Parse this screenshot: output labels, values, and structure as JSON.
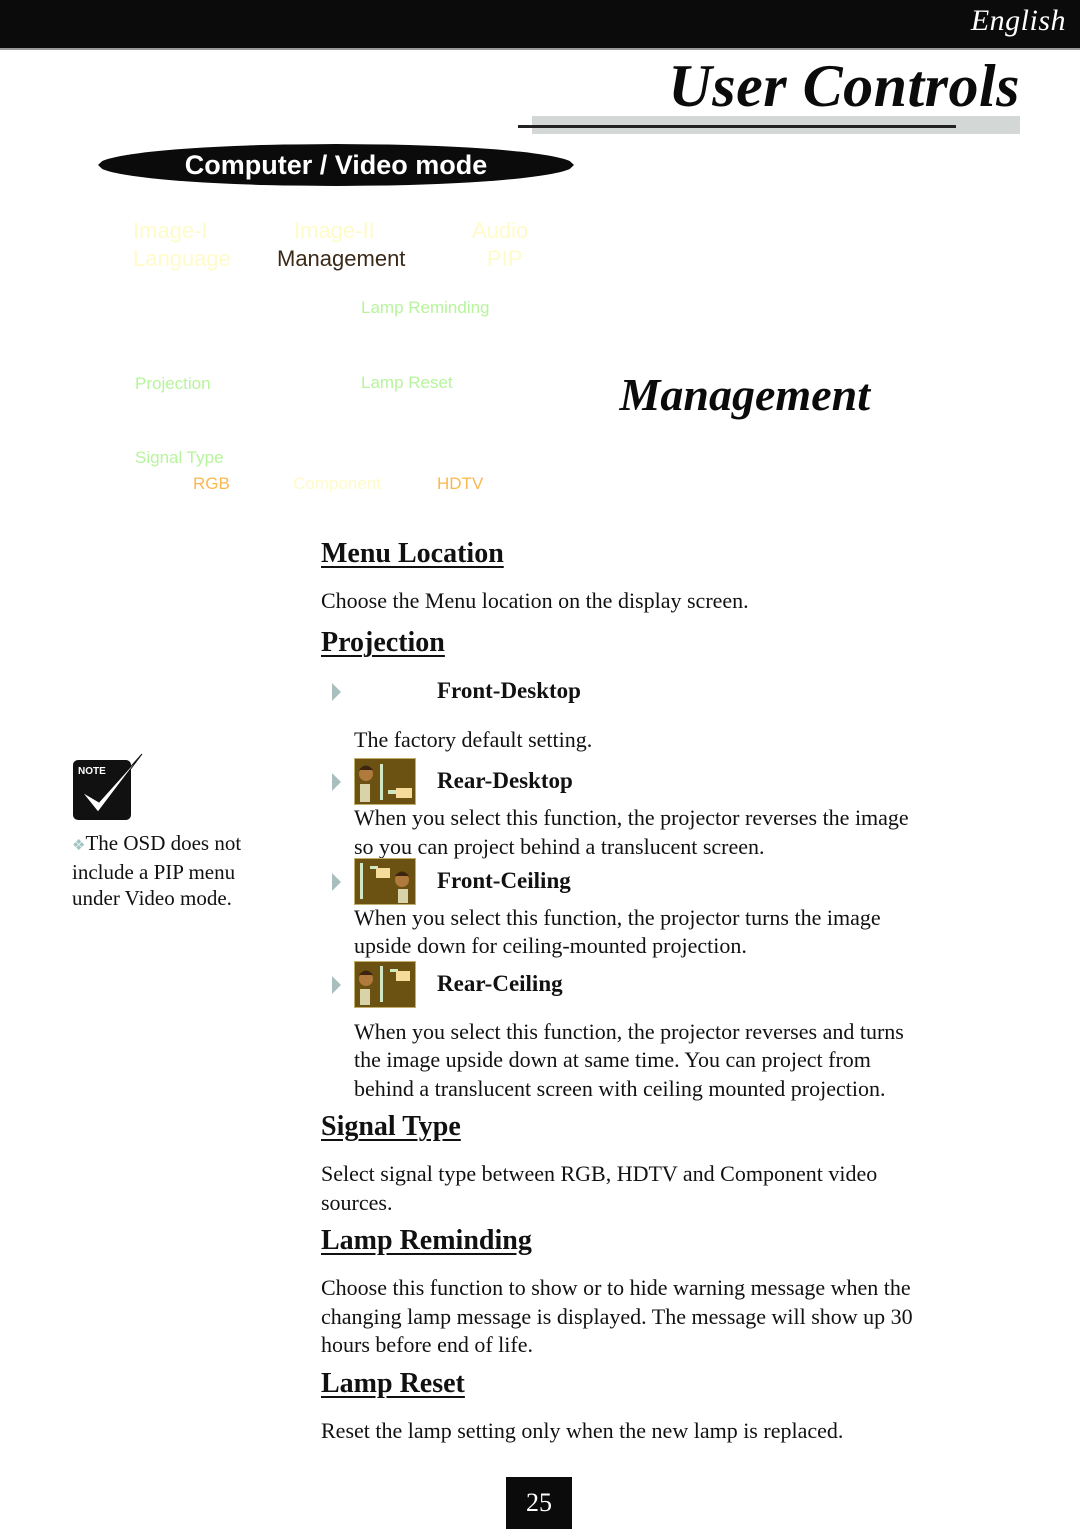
{
  "header": {
    "language": "English",
    "page_title": "User Controls"
  },
  "mode_banner": "Computer / Video mode",
  "osd_menu": {
    "tabs": [
      {
        "label": "Image-I",
        "active": false
      },
      {
        "label": "Image-II",
        "active": false
      },
      {
        "label": "Audio",
        "active": false
      },
      {
        "label": "Language",
        "active": false
      },
      {
        "label": "Management",
        "active": true
      },
      {
        "label": "PIP",
        "active": false
      }
    ],
    "items": {
      "lamp_reminding": "Lamp Reminding",
      "projection": "Projection",
      "lamp_reset": "Lamp Reset",
      "signal_type": "Signal Type"
    },
    "signal_options": [
      {
        "label": "RGB",
        "color": "#fbb84f"
      },
      {
        "label": "Component",
        "color": "#fffbc9"
      },
      {
        "label": "HDTV",
        "color": "#fbb84f"
      }
    ]
  },
  "section_heading": "Management",
  "sections": {
    "menu_location": {
      "title": "Menu Location",
      "text": "Choose the Menu location on the display screen."
    },
    "projection": {
      "title": "Projection",
      "options": [
        {
          "label": "Front-Desktop",
          "icon": "front-desktop-icon",
          "text": "The factory default setting."
        },
        {
          "label": "Rear-Desktop",
          "icon": "rear-desktop-icon",
          "text_lines": [
            "When you select this function, the projector reverses the image",
            "so you can project behind a translucent screen."
          ]
        },
        {
          "label": "Front-Ceiling",
          "icon": "front-ceiling-icon",
          "text_lines": [
            "When you select this function, the projector turns the image",
            "upside down for ceiling-mounted projection."
          ]
        },
        {
          "label": "Rear-Ceiling",
          "icon": "rear-ceiling-icon",
          "text_lines": [
            "When you select this function, the projector reverses and turns",
            "the image upside down at same time. You can project from",
            "behind a translucent screen with ceiling mounted projection."
          ]
        }
      ]
    },
    "signal_type": {
      "title": "Signal Type",
      "text_lines": [
        "Select signal type between RGB, HDTV and Component video",
        "sources."
      ]
    },
    "lamp_reminding": {
      "title": "Lamp Reminding",
      "text_lines": [
        "Choose this function to show or to hide warning message when the",
        "changing lamp message is displayed.  The message will show up 30",
        "hours before end of life."
      ]
    },
    "lamp_reset": {
      "title": "Lamp Reset",
      "text": "Reset the lamp setting only when the new lamp is replaced."
    }
  },
  "note": {
    "badge": "NOTE",
    "bullet": "❖",
    "lines": [
      "The OSD does not",
      "include a PIP menu",
      "under Video mode."
    ]
  },
  "page_number": "25"
}
